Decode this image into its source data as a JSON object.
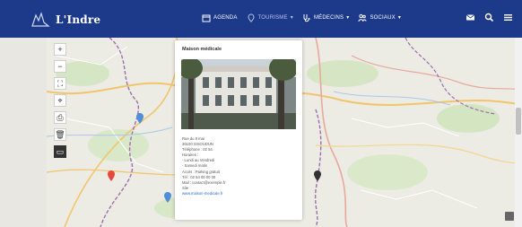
{
  "brand": {
    "name": "L'Indre",
    "tagline": ""
  },
  "nav": {
    "items": [
      {
        "label": "AGENDA",
        "icon": "calendar-icon",
        "muted": false,
        "has_caret": false
      },
      {
        "label": "TOURISME",
        "icon": "map-pin-icon",
        "muted": true,
        "has_caret": true
      },
      {
        "label": "MÉDECINS",
        "icon": "stethoscope-icon",
        "muted": false,
        "has_caret": true
      },
      {
        "label": "SOCIAUX",
        "icon": "people-icon",
        "muted": false,
        "has_caret": true
      }
    ],
    "right_icons": [
      "mail-icon",
      "search-icon",
      "menu-icon"
    ]
  },
  "map": {
    "controls": [
      {
        "name": "zoom-in-button",
        "symbol": "+"
      },
      {
        "name": "zoom-out-button",
        "symbol": "−"
      },
      {
        "name": "fullscreen-button",
        "symbol": "⛶"
      },
      {
        "name": "locate-button",
        "symbol": "⌖"
      },
      {
        "name": "print-button",
        "symbol": "⎙"
      },
      {
        "name": "trash-button",
        "symbol": "🗑"
      },
      {
        "name": "layers-button",
        "symbol": "▭"
      }
    ]
  },
  "popup": {
    "title": "Maison médicale",
    "lines": [
      "Rue du 8 mai",
      "36100 ISSOUDUN",
      "Téléphone : 02 54",
      "Horaires :",
      "- Lundi au Vendredi",
      "- Samedi matin",
      "Accès : Parking gratuit",
      "Tél : 02 54 00 00 00",
      "Mail : contact@exemple.fr",
      "Site :",
      "www.maison-medicale.fr"
    ],
    "link_indexes": [
      10
    ]
  },
  "colors": {
    "nav_bg": "#1d3a8a",
    "link": "#2c6bd1"
  }
}
